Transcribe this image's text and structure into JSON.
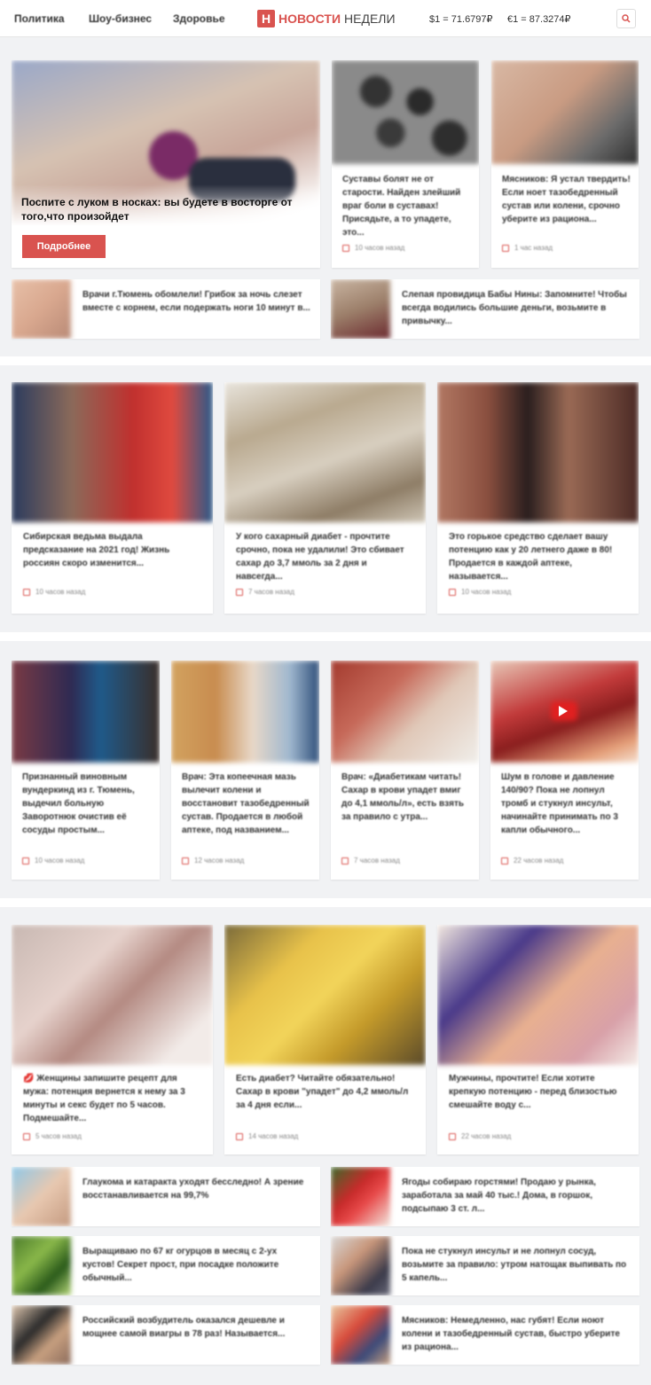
{
  "header": {
    "nav": [
      "Политика",
      "Шоу-бизнес",
      "Здоровье"
    ],
    "logo_mark": "Н",
    "logo_part1": "НОВОСТИ",
    "logo_part2": "НЕДЕЛИ",
    "usd_rate": "$1 = 71.6797₽",
    "eur_rate": "€1 = 87.3274₽",
    "search_icon": "search-icon"
  },
  "hero": {
    "title": "Поспите с луком в носках: вы будете в восторге от того,что произойдет",
    "button": "Подробнее"
  },
  "top_cards": [
    {
      "title": "Суставы болят не от старости. Найден злейший враг боли в суставах! Присядьте, а то упадете, это...",
      "time": "10 часов назад"
    },
    {
      "title": "Мясников: Я устал твердить! Если ноет тазобедренный сустав или колени, срочно уберите из рациона...",
      "time": "1 час назад"
    }
  ],
  "top_rows": [
    {
      "title": "Врачи г.Тюмень обомлели! Грибок за ночь слезет вместе с корнем, если подержать ноги 10 минут в..."
    },
    {
      "title": "Слепая провидица Бабы Нины: Запомните! Чтобы всегда водились большие деньги, возьмите в привычку..."
    }
  ],
  "section2": [
    {
      "title": "Сибирская ведьма выдала предсказание на 2021 год! Жизнь россиян скоро изменится...",
      "time": "10 часов назад"
    },
    {
      "title": "У кого сахарный диабет - прочтите срочно, пока не удалили! Это сбивает сахар до 3,7 ммоль за 2 дня и навсегда...",
      "time": "7 часов назад"
    },
    {
      "title": "Это горькое средство сделает вашу потенцию как у 20 летнего даже в 80! Продается в каждой аптеке, называется...",
      "time": "10 часов назад"
    }
  ],
  "section3": [
    {
      "title": "Признанный виновным вундеркинд из г. Тюмень, выдечил больную Заворотнюк очистив её сосуды простым...",
      "time": "10 часов назад"
    },
    {
      "title": "Врач: Эта копеечная мазь вылечит колени и восстановит тазобедренный сустав. Продается в любой аптеке, под названием...",
      "time": "12 часов назад"
    },
    {
      "title": "Врач: «Диабетикам читать! Сахар в крови упадет вмиг до 4,1 ммоль/л», есть взять за правило с утра...",
      "time": "7 часов назад"
    },
    {
      "title": "Шум в голове и давление 140/90? Пока не лопнул тромб и стукнул инсульт, начинайте принимать по 3 капли обычного...",
      "time": "22 часов назад"
    }
  ],
  "section4": [
    {
      "title": "💋 Женщины запишите рецепт для мужа: потенция вернется к нему за 3 минуты и секс будет по 5 часов. Подмешайте...",
      "time": "5 часов назад"
    },
    {
      "title": "Есть диабет? Читайте обязательно! Сахар в крови \"упадет\" до 4,2 ммоль/л за 4 дня если...",
      "time": "14 часов назад"
    },
    {
      "title": "Мужчины, прочтите! Если хотите крепкую потенцию - перед близостью смешайте воду с...",
      "time": "22 часов назад"
    }
  ],
  "bottom_rows": [
    {
      "title": "Глаукома и катаракта уходят бесследно! А зрение восстанавливается на 99,7%"
    },
    {
      "title": "Ягоды собираю горстями! Продаю у рынка, заработала за май 40 тыс.! Дома, в горшок, подсыпаю 3 ст. л..."
    },
    {
      "title": "Выращиваю по 67 кг огурцов в месяц с 2-ух кустов! Секрет прост, при посадке положите обычный..."
    },
    {
      "title": "Пока не стукнул инсульт и не лопнул сосуд, возьмите за правило: утром натощак выпивать по 5 капель..."
    },
    {
      "title": "Российский возбудитель оказался дешевле и мощнее самой виагры в 78 раз! Называется..."
    },
    {
      "title": "Мясников: Немедленно, нас губят! Если ноют колени и тазобедренный сустав, быстро уберите из рациона..."
    }
  ]
}
